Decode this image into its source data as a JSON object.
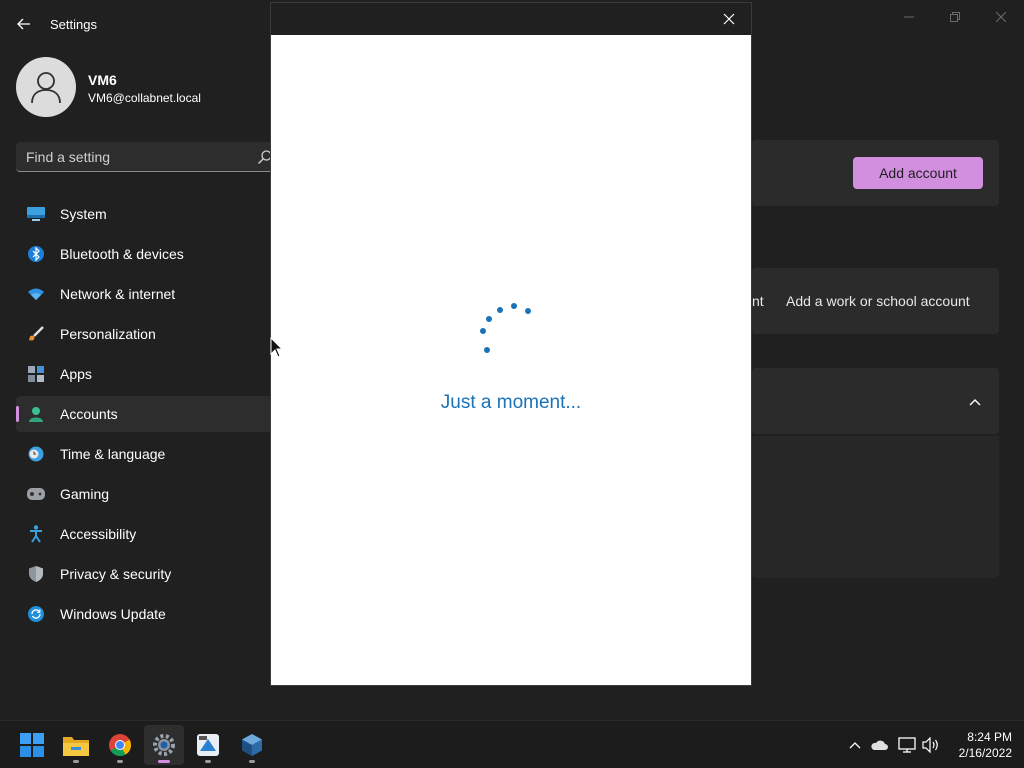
{
  "window": {
    "title": "Settings"
  },
  "profile": {
    "name": "VM6",
    "email": "VM6@collabnet.local"
  },
  "search": {
    "placeholder": "Find a setting"
  },
  "nav": {
    "items": [
      {
        "label": "System",
        "icon": "system-icon"
      },
      {
        "label": "Bluetooth & devices",
        "icon": "bluetooth-icon"
      },
      {
        "label": "Network & internet",
        "icon": "wifi-icon"
      },
      {
        "label": "Personalization",
        "icon": "brush-icon"
      },
      {
        "label": "Apps",
        "icon": "apps-icon"
      },
      {
        "label": "Accounts",
        "icon": "accounts-icon",
        "selected": true
      },
      {
        "label": "Time & language",
        "icon": "clock-globe-icon"
      },
      {
        "label": "Gaming",
        "icon": "gamepad-icon"
      },
      {
        "label": "Accessibility",
        "icon": "accessibility-icon"
      },
      {
        "label": "Privacy & security",
        "icon": "shield-icon"
      },
      {
        "label": "Windows Update",
        "icon": "update-icon"
      }
    ]
  },
  "content": {
    "add_account_label": "Add account",
    "partial_label": "nt",
    "work_account_label": "Add a work or school account"
  },
  "dialog": {
    "loading_text": "Just a moment..."
  },
  "taskbar": {
    "apps": [
      "start-icon",
      "file-explorer-icon",
      "chrome-icon",
      "settings-icon",
      "remote-tool-icon",
      "virtualbox-icon"
    ],
    "clock": {
      "time": "8:24 PM",
      "date": "2/16/2022"
    }
  },
  "colors": {
    "accent": "#d28fe0",
    "background": "#202020",
    "loading_blue": "#1a73b8"
  }
}
